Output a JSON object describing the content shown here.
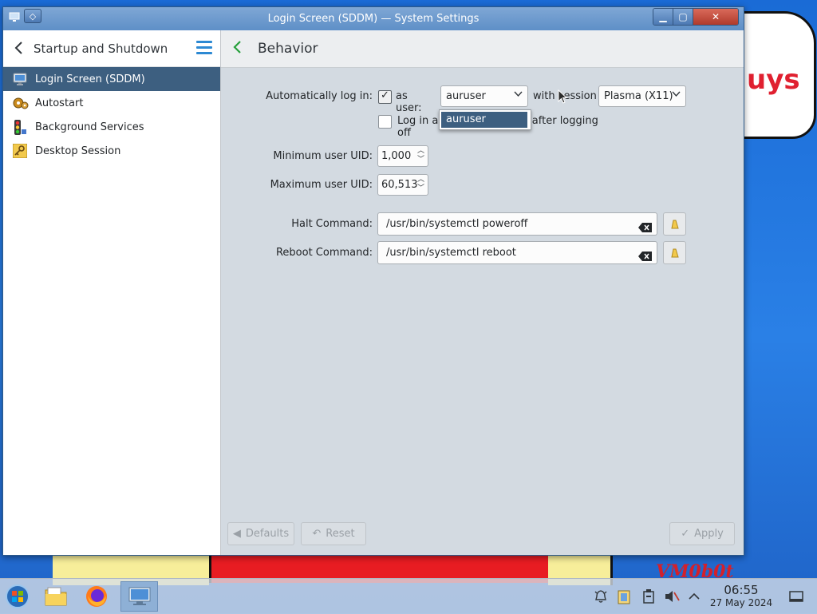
{
  "window": {
    "title": "Login Screen (SDDM) — System Settings",
    "buttons": {
      "minimize": "▁",
      "maximize": "▢",
      "close": "✕"
    }
  },
  "sidebar": {
    "title": "Startup and Shutdown",
    "items": [
      {
        "label": "Login Screen (SDDM)",
        "icon": "monitor-icon",
        "active": true
      },
      {
        "label": "Autostart",
        "icon": "gears-icon",
        "active": false
      },
      {
        "label": "Background Services",
        "icon": "traffic-light-icon",
        "active": false
      },
      {
        "label": "Desktop Session",
        "icon": "key-icon",
        "active": false
      }
    ]
  },
  "main": {
    "title": "Behavior",
    "autologin": {
      "label": "Automatically log in:",
      "checked": true,
      "as_user_label": "as user:",
      "user_value": "auruser",
      "user_options": [
        "auruser"
      ],
      "with_session_label": "with session",
      "session_value": "Plasma (X11)"
    },
    "relogin": {
      "label": "Log in again immediately after logging off",
      "checked": false
    },
    "min_uid": {
      "label": "Minimum user UID:",
      "value": "1,000"
    },
    "max_uid": {
      "label": "Maximum user UID:",
      "value": "60,513"
    },
    "halt": {
      "label": "Halt Command:",
      "value": "/usr/bin/systemctl poweroff"
    },
    "reboot": {
      "label": "Reboot Command:",
      "value": "/usr/bin/systemctl reboot"
    }
  },
  "footer": {
    "defaults_label": "Defaults",
    "reset_label": "Reset",
    "apply_label": "Apply"
  },
  "taskbar": {
    "clock_time": "06:55",
    "clock_date": "27 May 2024"
  },
  "wallpaper": {
    "cloud_text": "uys",
    "signature": "VM0b0t"
  }
}
